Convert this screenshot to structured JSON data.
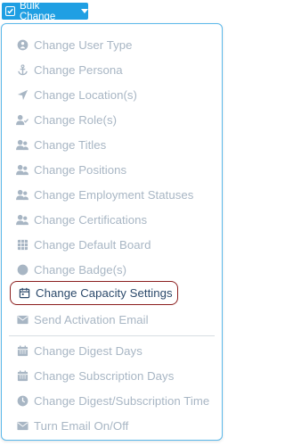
{
  "header": {
    "bulk_change_label": "Bulk Change"
  },
  "menu": {
    "items": [
      {
        "label": "Change User Type",
        "icon": "user-type-icon"
      },
      {
        "label": "Change Persona",
        "icon": "anchor-icon"
      },
      {
        "label": "Change Location(s)",
        "icon": "location-arrow-icon"
      },
      {
        "label": "Change Role(s)",
        "icon": "user-check-icon"
      },
      {
        "label": "Change Titles",
        "icon": "users-icon"
      },
      {
        "label": "Change Positions",
        "icon": "users-icon"
      },
      {
        "label": "Change Employment Statuses",
        "icon": "users-icon"
      },
      {
        "label": "Change Certifications",
        "icon": "users-icon"
      },
      {
        "label": "Change Default Board",
        "icon": "grid-icon"
      },
      {
        "label": "Change Badge(s)",
        "icon": "circle-icon"
      },
      {
        "label": "Change Capacity Settings",
        "icon": "calendar-icon"
      },
      {
        "label": "Send Activation Email",
        "icon": "envelope-icon"
      },
      {
        "label": "Change Digest Days",
        "icon": "calendar-icon"
      },
      {
        "label": "Change Subscription Days",
        "icon": "calendar-icon"
      },
      {
        "label": "Change Digest/Subscription Time",
        "icon": "clock-icon"
      },
      {
        "label": "Turn Email On/Off",
        "icon": "envelope-icon"
      }
    ]
  },
  "colors": {
    "accent": "#1f9fe3",
    "item_text": "#a8b6c4",
    "highlight_border": "#8b1e1e",
    "highlight_text": "#2c4a6b"
  }
}
